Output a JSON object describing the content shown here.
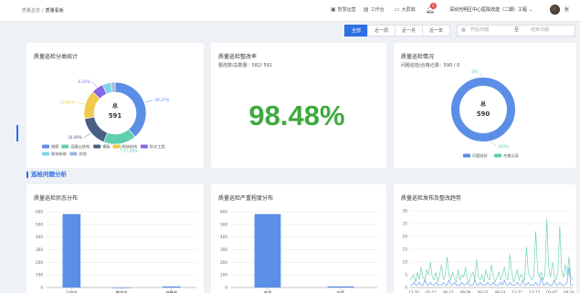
{
  "breadcrumb": {
    "items": [
      "质量总览",
      "质量看板"
    ]
  },
  "topbar": {
    "links": [
      "智慧运营",
      "工作台",
      "大屏端"
    ],
    "notification_count": "6",
    "project": "深圳光明区中心医院改建（二期）工程",
    "user": "张"
  },
  "filters": {
    "options": [
      "全部",
      "近一周",
      "近一月",
      "近一年"
    ],
    "active": "全部",
    "start_placeholder": "开始日期",
    "to_label": "至",
    "end_placeholder": "结束日期"
  },
  "cards": {
    "category": {
      "title": "质量巡检分类统计",
      "center_label": "总",
      "center_value": "591",
      "legend": [
        "钢筋",
        "混凝土结构",
        "模板",
        "砌体结构",
        "防水工程",
        "装饰装修",
        "其他"
      ]
    },
    "rectify": {
      "title": "质量巡检整改率",
      "subtitle": "整改数/总数量：582/ 591",
      "rate": "98.48%"
    },
    "check": {
      "title": "质量巡检情况",
      "subtitle": "问题巡检/合格记录：590 / 0",
      "center_label": "总",
      "center_value": "590",
      "legend": [
        "问题巡检",
        "合格记录"
      ]
    },
    "status": {
      "title": "质量巡检状态分布"
    },
    "severity": {
      "title": "质量巡检严重程度分布"
    },
    "trend": {
      "title": "质量巡检发布及整改趋势"
    }
  },
  "section": {
    "title": "巡检问题分析"
  },
  "colors": {
    "blue": "#5b8ee6",
    "teal": "#5fcfae",
    "navy": "#4a5f82",
    "yellow": "#f2c94c",
    "purple": "#8a67e6",
    "cyan": "#7fd3e8",
    "green": "#3eaa3e",
    "accent": "#2f6fe4"
  },
  "chart_data": [
    {
      "type": "pie",
      "categories": [
        "钢筋",
        "混凝土结构",
        "模板",
        "砌体结构",
        "防水工程",
        "装饰装修",
        "其他"
      ],
      "values": [
        230,
        101,
        95,
        89,
        37,
        27,
        12
      ],
      "slice_labels": [
        "39.27%",
        "17.09%",
        "16.09%",
        "15.06%",
        "6.26%",
        "4.57%",
        "2.03%"
      ],
      "visible_labels": [
        "39.27%",
        "17.09%",
        "16.09%",
        "15.06%",
        "6.26%",
        "",
        ""
      ],
      "title": "质量巡检分类统计"
    },
    {
      "type": "pie",
      "categories": [
        "问题巡检",
        "合格记录"
      ],
      "values": [
        590,
        0
      ],
      "slice_labels": [
        "100%",
        "0%"
      ],
      "title": "质量巡检情况"
    },
    {
      "type": "bar",
      "categories": [
        "已完成",
        "整改中",
        "待整改"
      ],
      "values": [
        582,
        0,
        9
      ],
      "ylim": [
        0,
        600
      ],
      "yticks": [
        0,
        100,
        200,
        300,
        400,
        500,
        600
      ],
      "title": "质量巡检状态分布"
    },
    {
      "type": "bar",
      "categories": [
        "普通",
        "中等"
      ],
      "values": [
        582,
        9
      ],
      "ylim": [
        0,
        600
      ],
      "yticks": [
        0,
        100,
        200,
        300,
        400,
        500,
        600
      ],
      "title": "质量巡检严重程度分布"
    },
    {
      "type": "line",
      "x_tick_labels": [
        "12-20",
        "01-12",
        "06-23",
        "08-08",
        "08-22",
        "09-14",
        "11-21",
        "12-17",
        "03-07",
        "04-24"
      ],
      "ylim": [
        0,
        30
      ],
      "yticks": [
        0,
        5,
        10,
        15,
        20,
        25,
        30
      ],
      "series": [
        {
          "color": "teal",
          "values": [
            3,
            4,
            5,
            2,
            6,
            3,
            8,
            4,
            3,
            7,
            5,
            10,
            4,
            3,
            6,
            2,
            5,
            9,
            3,
            4,
            12,
            5,
            3,
            6,
            4,
            2,
            7,
            3,
            5,
            4,
            8,
            3,
            2,
            5,
            6,
            3,
            11,
            4,
            3,
            5,
            2,
            7,
            4,
            3,
            9,
            5,
            2,
            4,
            6,
            3,
            5,
            8,
            4,
            3,
            13,
            6,
            2,
            4,
            7,
            3,
            5,
            4,
            3,
            16,
            6,
            4,
            3,
            5,
            22,
            7,
            4,
            6,
            3,
            5,
            27,
            8,
            4,
            10,
            5,
            3,
            6,
            24,
            7,
            4,
            9,
            5,
            12,
            4,
            3
          ]
        },
        {
          "color": "blue",
          "values": [
            1,
            1,
            2,
            1,
            1,
            2,
            1,
            1,
            3,
            1,
            1,
            2,
            1,
            1,
            2,
            1,
            1,
            1,
            2,
            1,
            1,
            3,
            1,
            1,
            2,
            1,
            1,
            1,
            2,
            1,
            1,
            2,
            1,
            1,
            1,
            3,
            1,
            1,
            2,
            1,
            1,
            1,
            2,
            1,
            1,
            2,
            1,
            1,
            1,
            2,
            1,
            3,
            1,
            1,
            2,
            1,
            1,
            1,
            2,
            1,
            1,
            3,
            1,
            1,
            2,
            1,
            1,
            1,
            2,
            1,
            1,
            4,
            1,
            1,
            2,
            1,
            1,
            1,
            3,
            1,
            1,
            2,
            1,
            1,
            1,
            2,
            8,
            1,
            1
          ]
        }
      ],
      "title": "质量巡检发布及整改趋势"
    }
  ]
}
